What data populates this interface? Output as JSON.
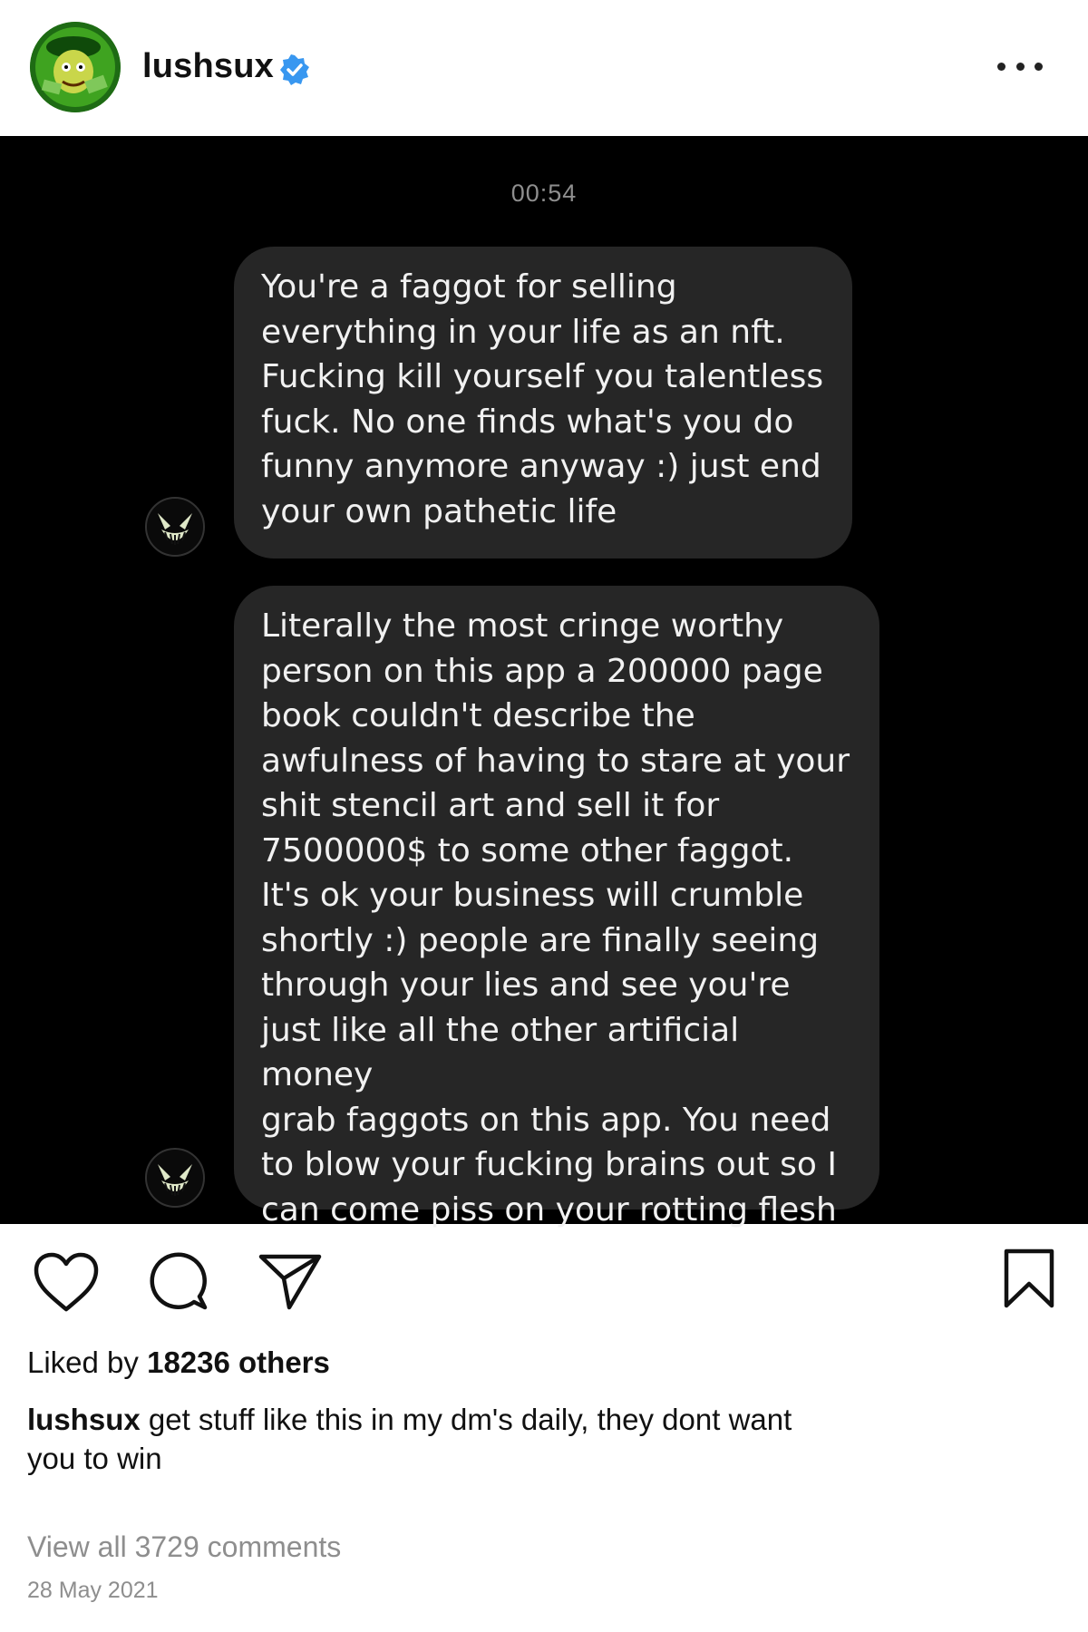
{
  "post": {
    "username": "lushsux",
    "verified": true,
    "more_icon": "more-dots-icon",
    "colors": {
      "verified": "#3897f0",
      "dm_background": "#000000",
      "bubble": "#262626",
      "muted_text": "#8e8e8e"
    }
  },
  "dm": {
    "time": "00:54",
    "messages": [
      "You're a faggot for selling\neverything in your life as an nft.\nFucking kill yourself you talentless\nfuck. No one finds what's you do\nfunny anymore anyway :) just end\nyour own pathetic life",
      "Literally the most cringe worthy\nperson on this app a 200000 page\nbook couldn't describe the\nawfulness of having to stare at your\nshit stencil art and sell it for\n7500000$ to some other faggot.\nIt's ok your business will crumble\nshortly :) people are finally seeing\nthrough your lies and see you're\njust like all the other artificial money\ngrab faggots on this app. You need\nto blow your fucking brains out so I\ncan come piss on your rotting flesh"
    ]
  },
  "actions": {
    "like_icon": "heart-icon",
    "comment_icon": "comment-icon",
    "share_icon": "paper-plane-icon",
    "save_icon": "bookmark-icon"
  },
  "likes": {
    "prefix": "Liked by ",
    "count_text": "18236 others"
  },
  "caption": {
    "username": "lushsux",
    "text": " get stuff like this in my dm's daily, they dont want you to win"
  },
  "comments_link": "View all 3729 comments",
  "date": "28 May 2021"
}
